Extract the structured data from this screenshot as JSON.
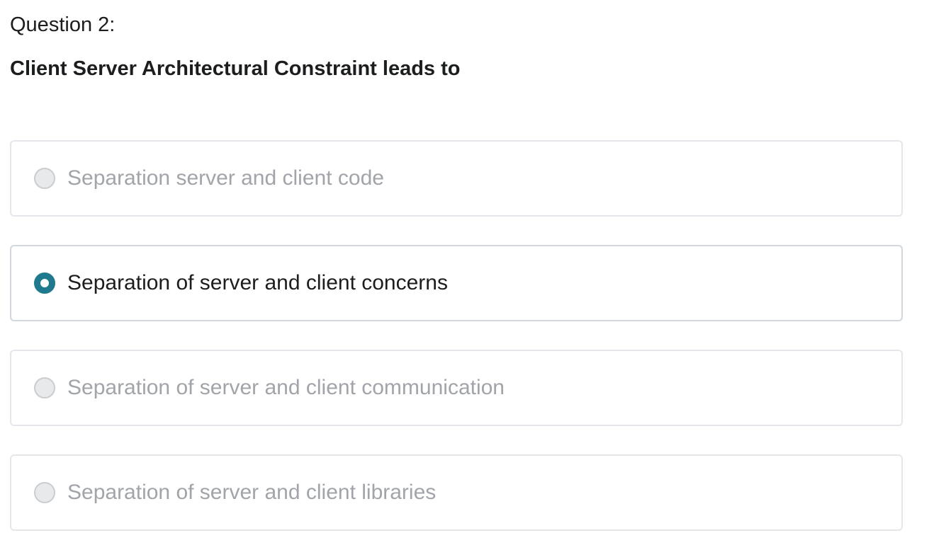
{
  "question": {
    "number_label": "Question 2:",
    "text": "Client Server Architectural Constraint leads to"
  },
  "options": [
    {
      "label": "Separation server and client code",
      "selected": false
    },
    {
      "label": "Separation of server and client concerns",
      "selected": true
    },
    {
      "label": "Separation of server and client communication",
      "selected": false
    },
    {
      "label": "Separation of server and client libraries",
      "selected": false
    }
  ],
  "colors": {
    "accent": "#1e7a8c",
    "text": "#1c1d1f",
    "muted_text": "#a1a4a9",
    "border": "#e4e6e9"
  }
}
